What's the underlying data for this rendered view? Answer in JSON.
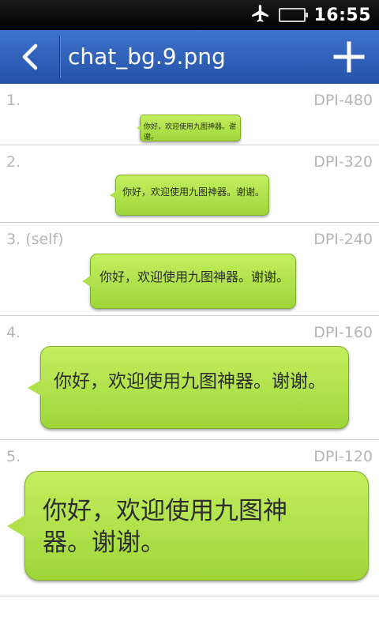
{
  "status_bar": {
    "time": "16:55",
    "icons": [
      "airplane-icon",
      "battery-icon"
    ]
  },
  "title_bar": {
    "title": "chat_bg.9.png",
    "back_icon": "chevron-left-icon",
    "add_icon": "plus-icon"
  },
  "rows": [
    {
      "index": "1.",
      "dpi": "DPI-480",
      "message": "你好，欢迎使用九图神器。谢谢。"
    },
    {
      "index": "2.",
      "dpi": "DPI-320",
      "message": "你好，欢迎使用九图神器。谢谢。"
    },
    {
      "index": "3. (self)",
      "dpi": "DPI-240",
      "message": "你好，欢迎使用九图神器。谢谢。"
    },
    {
      "index": "4.",
      "dpi": "DPI-160",
      "message": "你好，欢迎使用九图神器。谢谢。"
    },
    {
      "index": "5.",
      "dpi": "DPI-120",
      "message": "你好，欢迎使用九图神器。谢谢。"
    }
  ],
  "colors": {
    "title_bar": "#2f5fb8",
    "bubble": "#b2e24b",
    "muted_text": "#b5b5b5"
  }
}
